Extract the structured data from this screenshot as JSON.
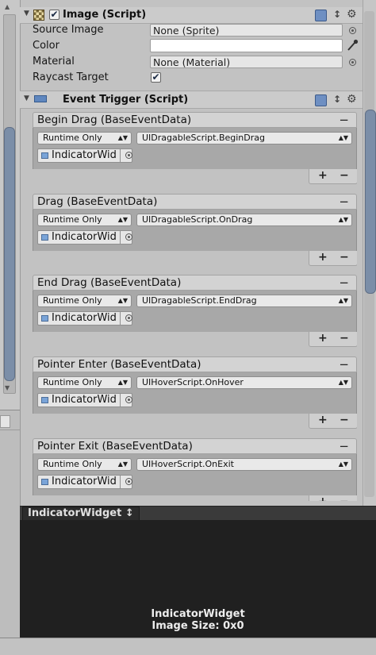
{
  "image_component": {
    "title": "Image (Script)",
    "properties": [
      {
        "label": "Source Image",
        "value": "None (Sprite)"
      },
      {
        "label": "Color",
        "value": ""
      },
      {
        "label": "Material",
        "value": "None (Material)"
      },
      {
        "label": "Raycast Target",
        "value": "✔"
      }
    ],
    "enabled_check": "✔"
  },
  "event_trigger": {
    "title": "Event Trigger (Script)",
    "events": [
      {
        "name": "Begin Drag (BaseEventData)",
        "mode": "Runtime Only",
        "function": "UIDragableScript.BeginDrag",
        "object": "IndicatorWid"
      },
      {
        "name": "Drag (BaseEventData)",
        "mode": "Runtime Only",
        "function": "UIDragableScript.OnDrag",
        "object": "IndicatorWid"
      },
      {
        "name": "End Drag (BaseEventData)",
        "mode": "Runtime Only",
        "function": "UIDragableScript.EndDrag",
        "object": "IndicatorWid"
      },
      {
        "name": "Pointer Enter (BaseEventData)",
        "mode": "Runtime Only",
        "function": "UIHoverScript.OnHover",
        "object": "IndicatorWid"
      },
      {
        "name": "Pointer Exit (BaseEventData)",
        "mode": "Runtime Only",
        "function": "UIHoverScript.OnExit",
        "object": "IndicatorWid"
      }
    ]
  },
  "symbols": {
    "minus": "−",
    "plus": "+",
    "dropdown_arrow": "▲▼",
    "menu_arrow": "↕",
    "gear": "⚙",
    "collapse": "▼"
  },
  "preview": {
    "dropdown_label": "IndicatorWidget ↕",
    "name": "IndicatorWidget",
    "size_text": "Image Size: 0x0"
  },
  "colors": {
    "accent_blue": "#6e8fc2",
    "preview_bg": "#202020",
    "panel_bg": "#c2c2c2"
  }
}
